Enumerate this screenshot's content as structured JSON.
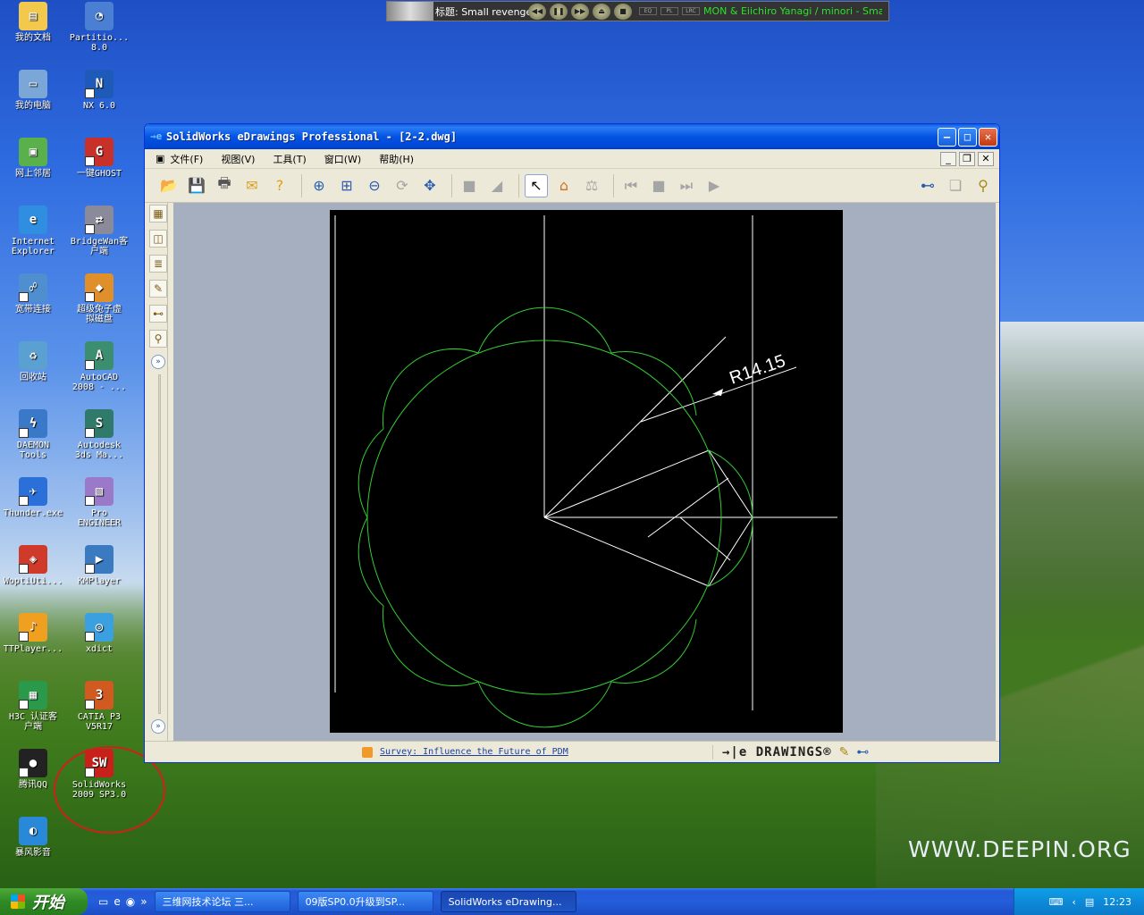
{
  "desktop": {
    "icons": [
      {
        "label": "我的文档",
        "name": "my-documents-icon",
        "color": "#f2c94c",
        "glyph": "▤",
        "shortcut": false
      },
      {
        "label": "Partitio...\n8.0",
        "name": "partition-magic-icon",
        "color": "#4a7fd4",
        "glyph": "◔",
        "shortcut": false
      },
      {
        "label": "我的电脑",
        "name": "my-computer-icon",
        "color": "#7aa6d8",
        "glyph": "▭",
        "shortcut": false
      },
      {
        "label": "NX 6.0",
        "name": "nx-icon",
        "color": "#1e5bb8",
        "glyph": "N",
        "shortcut": true
      },
      {
        "label": "网上邻居",
        "name": "network-places-icon",
        "color": "#5ab04a",
        "glyph": "▣",
        "shortcut": false
      },
      {
        "label": "一键GHOST",
        "name": "ghost-icon",
        "color": "#c8302a",
        "glyph": "G",
        "shortcut": true
      },
      {
        "label": "Internet\nExplorer",
        "name": "internet-explorer-icon",
        "color": "#2f8ee0",
        "glyph": "e",
        "shortcut": false
      },
      {
        "label": "BridgeWan客\n户端",
        "name": "bridgewan-icon",
        "color": "#8a8a9a",
        "glyph": "⇄",
        "shortcut": true
      },
      {
        "label": "宽带连接",
        "name": "broadband-icon",
        "color": "#4f8fd0",
        "glyph": "☍",
        "shortcut": true
      },
      {
        "label": "超级兔子虚\n拟磁盘",
        "name": "virtual-disk-icon",
        "color": "#e0902a",
        "glyph": "◆",
        "shortcut": true
      },
      {
        "label": "回收站",
        "name": "recycle-bin-icon",
        "color": "#5aa0d0",
        "glyph": "♻",
        "shortcut": false
      },
      {
        "label": "AutoCAD\n2008 - ...",
        "name": "autocad-icon",
        "color": "#3b8e70",
        "glyph": "A",
        "shortcut": true
      },
      {
        "label": "DAEMON\nTools",
        "name": "daemon-tools-icon",
        "color": "#3a78c8",
        "glyph": "ϟ",
        "shortcut": true
      },
      {
        "label": "Autodesk\n3ds Ma...",
        "name": "3ds-max-icon",
        "color": "#2f7a6a",
        "glyph": "S",
        "shortcut": true
      },
      {
        "label": "Thunder.exe",
        "name": "thunder-icon",
        "color": "#2a70d8",
        "glyph": "✈",
        "shortcut": true
      },
      {
        "label": "Pro\nENGINEER",
        "name": "pro-engineer-icon",
        "color": "#9a7ac8",
        "glyph": "▧",
        "shortcut": true
      },
      {
        "label": "WoptiUti...",
        "name": "wopti-icon",
        "color": "#d03a2a",
        "glyph": "◈",
        "shortcut": true
      },
      {
        "label": "KMPlayer",
        "name": "kmplayer-icon",
        "color": "#3a7ac0",
        "glyph": "▶",
        "shortcut": true
      },
      {
        "label": "TTPlayer...",
        "name": "ttplayer-icon",
        "color": "#f0a020",
        "glyph": "♪",
        "shortcut": true
      },
      {
        "label": "xdict",
        "name": "xdict-icon",
        "color": "#3aa0e0",
        "glyph": "◎",
        "shortcut": true
      },
      {
        "label": "H3C 认证客\n户端",
        "name": "h3c-icon",
        "color": "#2a9a4a",
        "glyph": "▦",
        "shortcut": true
      },
      {
        "label": "CATIA P3\nV5R17",
        "name": "catia-icon",
        "color": "#d05a20",
        "glyph": "3",
        "shortcut": true
      },
      {
        "label": "腾讯QQ",
        "name": "qq-icon",
        "color": "#222222",
        "glyph": "●",
        "shortcut": true
      },
      {
        "label": "SolidWorks\n2009 SP3.0",
        "name": "solidworks-icon",
        "color": "#c8201a",
        "glyph": "SW",
        "shortcut": true
      },
      {
        "label": "暴风影音",
        "name": "storm-player-icon",
        "color": "#2a88d8",
        "glyph": "◐",
        "shortcut": false
      }
    ],
    "watermark": "WWW.DEEPIN.ORG"
  },
  "media_player": {
    "title": "标题: Small revenge",
    "artist_scroll": "MON & Eiichiro Yanagi / minori - Small reve",
    "mini_labels": [
      "EQ",
      "PL",
      "LRC"
    ]
  },
  "window": {
    "title": "SolidWorks eDrawings Professional - [2-2.dwg]",
    "menu": [
      "文件(F)",
      "视图(V)",
      "工具(T)",
      "窗口(W)",
      "帮助(H)"
    ],
    "status": {
      "link": "Survey: Influence the Future of PDM",
      "brand": "→|e DRAWINGS®"
    }
  },
  "drawing": {
    "dimension_text": "R14.15",
    "line_color": "#ffffff",
    "curve_color": "#33cc33"
  },
  "taskbar": {
    "start_label": "开始",
    "tasks": [
      "三维网技术论坛 三...",
      "09版SP0.0升级到SP...",
      "SolidWorks eDrawing..."
    ],
    "clock": "12:23"
  }
}
